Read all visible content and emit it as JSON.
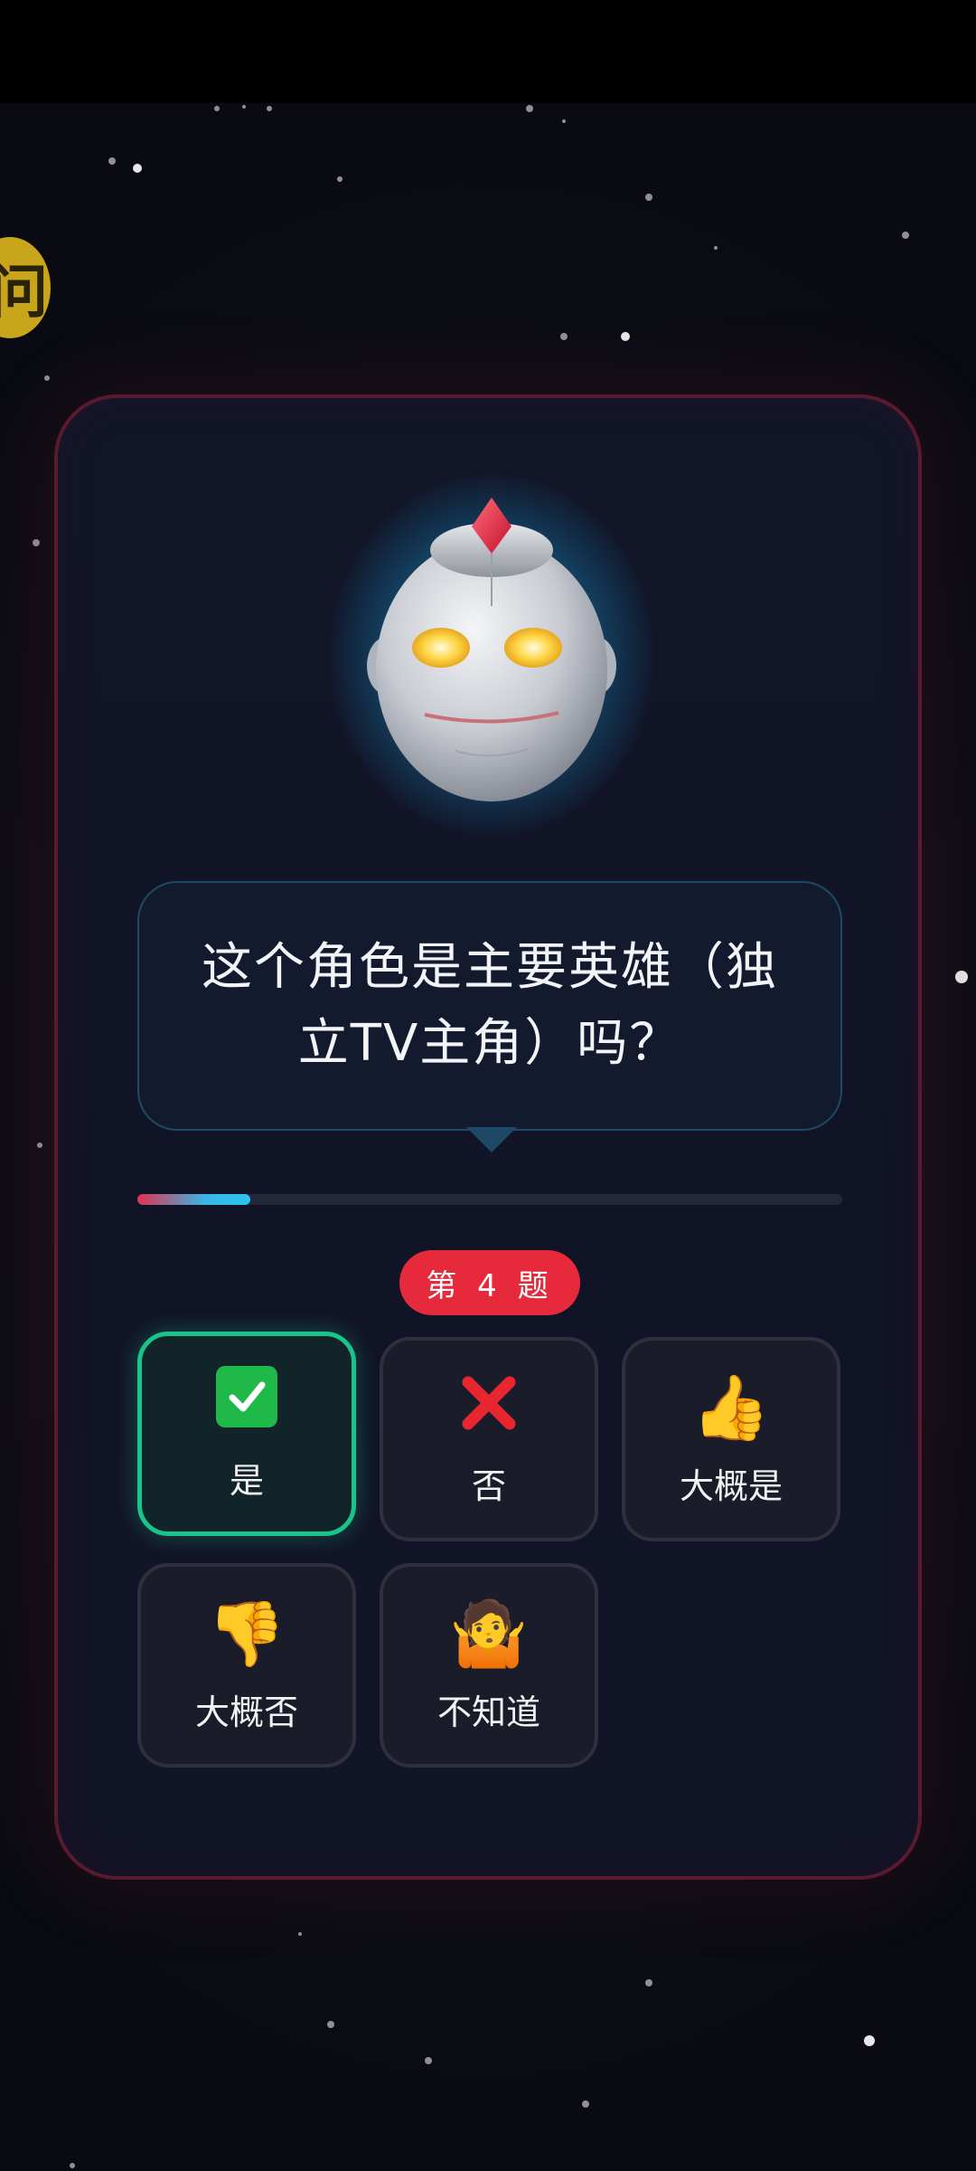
{
  "colors": {
    "background": "#0c0d14",
    "card_border": "#5a1a2e",
    "accent_red": "#e62a3c",
    "selected_green": "#19c48a",
    "progress_start": "#e0334f",
    "progress_end": "#2bc4f0",
    "hint_yellow": "#c9a51c"
  },
  "hint_button": {
    "icon": "hint-icon",
    "text": "问"
  },
  "avatar": {
    "icon": "genie-robot-head-icon"
  },
  "question": {
    "text": "这个角色是主要英雄（独立TV主角）吗？"
  },
  "progress": {
    "fraction": 0.16
  },
  "question_number": {
    "label": "第 4 题"
  },
  "answers": [
    {
      "label": "是",
      "icon": "check-mark-icon",
      "emoji": "✅",
      "selected": true
    },
    {
      "label": "否",
      "icon": "cross-mark-icon",
      "emoji": "❌",
      "selected": false
    },
    {
      "label": "大概是",
      "icon": "thumbs-up-icon",
      "emoji": "👍",
      "selected": false
    },
    {
      "label": "大概否",
      "icon": "thumbs-down-icon",
      "emoji": "👎",
      "selected": false
    },
    {
      "label": "不知道",
      "icon": "shrug-icon",
      "emoji": "🤷",
      "selected": false
    }
  ]
}
